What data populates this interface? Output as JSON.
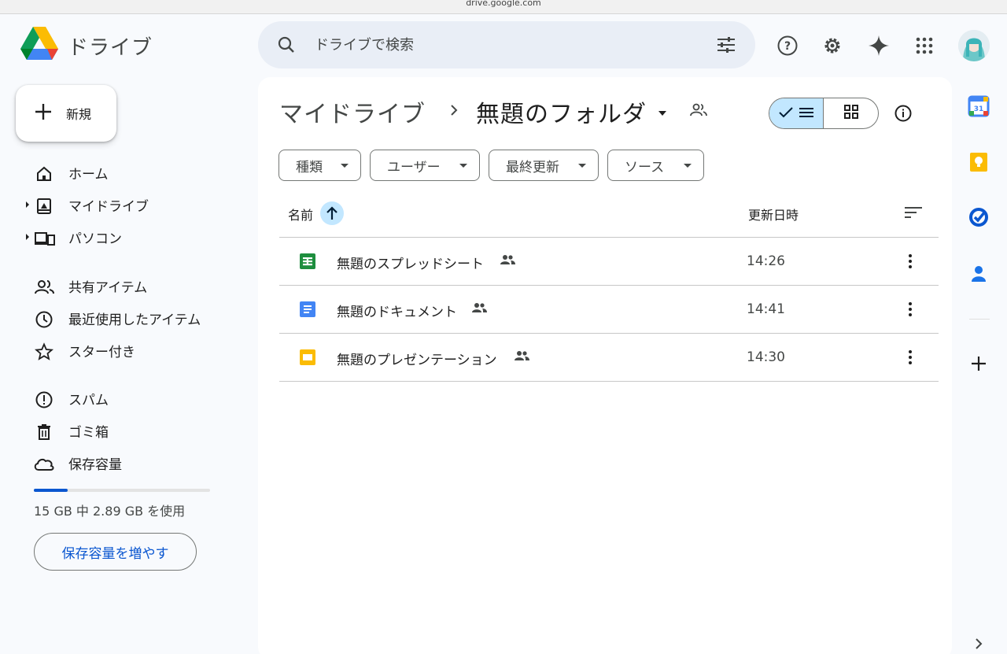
{
  "browser": {
    "url": "drive.google.com"
  },
  "app": {
    "name": "ドライブ"
  },
  "search": {
    "placeholder": "ドライブで検索"
  },
  "new_button": {
    "label": "新規"
  },
  "nav": {
    "items": [
      {
        "label": "ホーム",
        "icon": "home-icon"
      },
      {
        "label": "マイドライブ",
        "icon": "my-drive-icon"
      },
      {
        "label": "パソコン",
        "icon": "computers-icon"
      },
      {
        "label": "共有アイテム",
        "icon": "shared-icon"
      },
      {
        "label": "最近使用したアイテム",
        "icon": "clock-icon"
      },
      {
        "label": "スター付き",
        "icon": "star-icon"
      },
      {
        "label": "スパム",
        "icon": "spam-icon"
      },
      {
        "label": "ゴミ箱",
        "icon": "trash-icon"
      },
      {
        "label": "保存容量",
        "icon": "cloud-icon"
      }
    ]
  },
  "storage": {
    "used_text": "15 GB 中 2.89 GB を使用",
    "used_fraction": 0.19,
    "buy_label": "保存容量を増やす"
  },
  "breadcrumb": {
    "root": "マイドライブ",
    "current": "無題のフォルダ"
  },
  "filters": [
    "種類",
    "ユーザー",
    "最終更新",
    "ソース"
  ],
  "table": {
    "col_name": "名前",
    "col_modified": "更新日時",
    "rows": [
      {
        "name": "無題のスプレッドシート",
        "type": "sheets-icon",
        "modified": "14:26"
      },
      {
        "name": "無題のドキュメント",
        "type": "docs-icon",
        "modified": "14:41"
      },
      {
        "name": "無題のプレゼンテーション",
        "type": "slides-icon",
        "modified": "14:30"
      }
    ]
  },
  "side_apps": [
    "calendar-icon",
    "keep-icon",
    "tasks-icon",
    "contacts-icon",
    "add-icon"
  ],
  "colors": {
    "accent": "#0b57d0",
    "selected": "#c2e7ff",
    "background": "#f8fafd",
    "sheets": "#1e8e3e",
    "docs": "#4285f4",
    "slides": "#fbbc04"
  }
}
